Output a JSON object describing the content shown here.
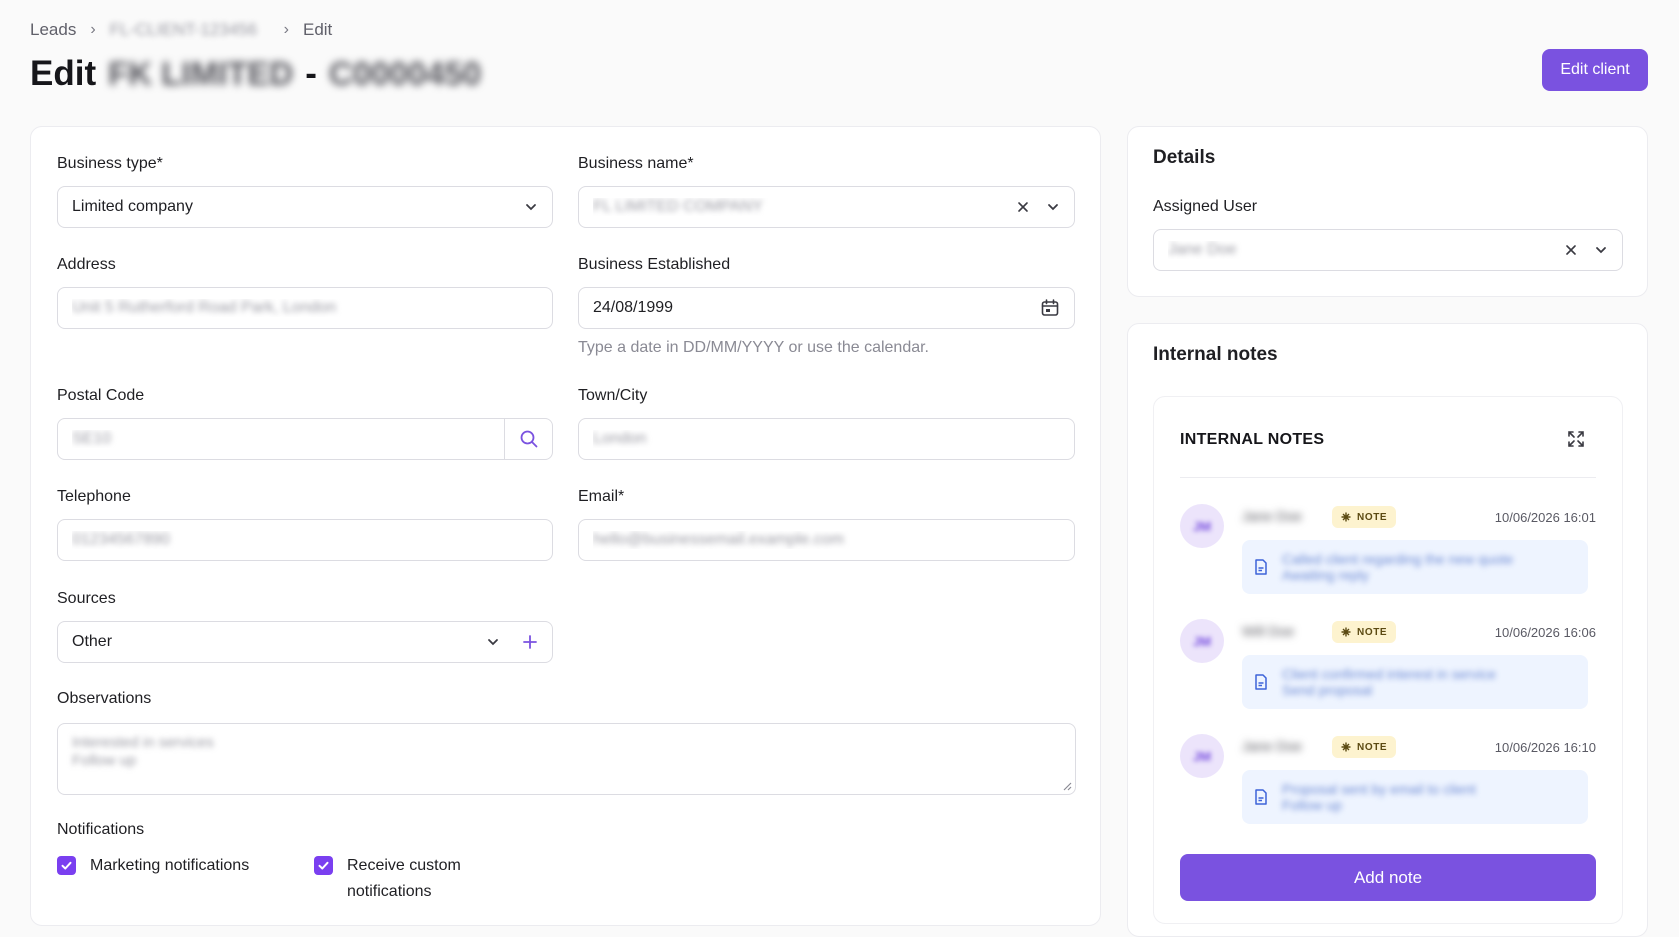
{
  "breadcrumb": {
    "root": "Leads",
    "client": "FL-CLIENT-123456",
    "current": "Edit"
  },
  "header": {
    "title_prefix": "Edit",
    "client_name": "FK LIMITED",
    "separator": "-",
    "client_code": "C0000450",
    "edit_client_label": "Edit client"
  },
  "form": {
    "business_type": {
      "label": "Business type*",
      "value": "Limited company"
    },
    "business_name": {
      "label": "Business name*",
      "value": "FL LIMITED COMPANY"
    },
    "address": {
      "label": "Address",
      "value": "Unit 5 Rutherford Road Park, London"
    },
    "business_established": {
      "label": "Business Established",
      "value": "24/08/1999",
      "hint": "Type a date in DD/MM/YYYY or use the calendar."
    },
    "postal_code": {
      "label": "Postal Code",
      "value": "SE10"
    },
    "town_city": {
      "label": "Town/City",
      "value": "London"
    },
    "telephone": {
      "label": "Telephone",
      "value": "01234567890"
    },
    "email": {
      "label": "Email*",
      "value": "hello@businessemail.example.com"
    },
    "sources": {
      "label": "Sources",
      "value": "Other"
    },
    "observations": {
      "label": "Observations",
      "value": "Interested in services",
      "value2": "Follow up"
    },
    "notifications": {
      "label": "Notifications",
      "marketing_label": "Marketing notifications",
      "custom_label_line1": "Receive custom",
      "custom_label_line2": "notifications"
    }
  },
  "details": {
    "title": "Details",
    "assigned_user_label": "Assigned User",
    "assigned_user_value": "Jane Doe"
  },
  "internal_notes": {
    "title": "Internal notes",
    "panel_title": "INTERNAL NOTES",
    "add_note_label": "Add note",
    "notes": [
      {
        "initials": "JM",
        "author": "Jane Doe",
        "badge": "NOTE",
        "time": "10/06/2026 16:01",
        "text": "Called client regarding the new quote",
        "text2": "Awaiting reply"
      },
      {
        "initials": "JM",
        "author": "Will Doe",
        "badge": "NOTE",
        "time": "10/06/2026 16:06",
        "text": "Client confirmed interest in service",
        "text2": "Send proposal"
      },
      {
        "initials": "JM",
        "author": "Jane Doe",
        "badge": "NOTE",
        "time": "10/06/2026 16:10",
        "text": "Proposal sent by email to client",
        "text2": "Follow up"
      }
    ]
  },
  "colors": {
    "accent": "#7a52e0",
    "checkbox": "#7a3ff0",
    "badge_bg": "#fdf3cf",
    "note_bg": "#eef4ff"
  }
}
